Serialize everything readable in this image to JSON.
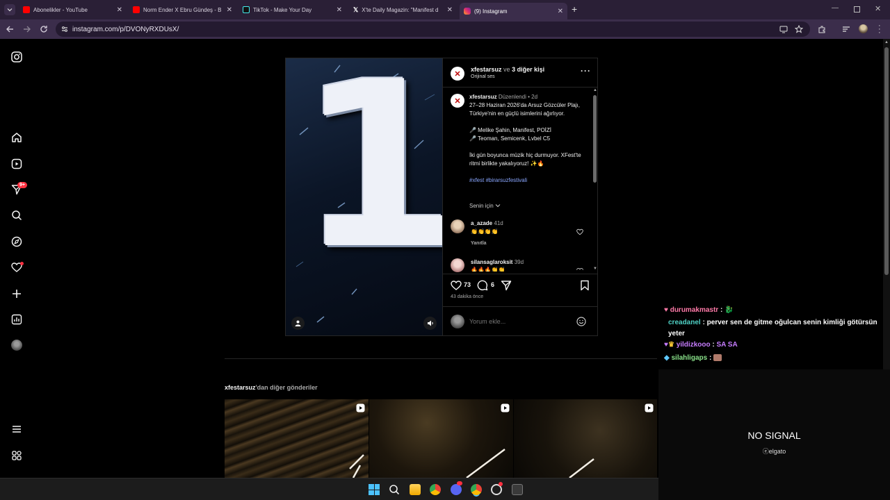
{
  "browser": {
    "tabs": [
      {
        "title": "Abonelikler - YouTube",
        "icon": "youtube-icon",
        "color": "#ff0000"
      },
      {
        "title": "Norm Ender X Ebru Gündeş - B",
        "icon": "youtube-icon",
        "color": "#ff0000"
      },
      {
        "title": "TikTok - Make Your Day",
        "icon": "tiktok-icon",
        "color": "#111111"
      },
      {
        "title": "X'te Daily Magazin: \"Manifest d",
        "icon": "x-icon",
        "color": "#000000"
      },
      {
        "title": "(9) Instagram",
        "icon": "instagram-icon",
        "color": "#e1306c"
      }
    ],
    "url": "instagram.com/p/DVONyRXDUsX/"
  },
  "sidebar": {
    "badge": "9+",
    "items": [
      "instagram-logo",
      "home",
      "reels",
      "messages",
      "search",
      "explore",
      "notifications",
      "create",
      "dashboard",
      "profile",
      "more",
      "also-from-meta"
    ]
  },
  "post": {
    "author": "xfestarsuz",
    "coauthors_connector": "ve",
    "coauthors": "3 diğer kişi",
    "audio": "Orijinal ses",
    "media_number": "1",
    "caption": {
      "username": "xfestarsuz",
      "edited": "Düzenlendi",
      "time": "2d",
      "line1": "27–28 Haziran 2026'da Arsuz Gözcüler Plajı, Türkiye'nin en güçlü isimlerini ağırlıyor.",
      "line2": "🎤 Melike Şahin, Manifest, POİZİ",
      "line3": "🎤 Teoman, Semicenk, Lvbel C5",
      "line4": "İki gün boyunca müzik hiç durmuyor. XFest'te ritmi birlikte yakalıyoruz! ✨🔥",
      "hashtags": "#xfest #birarsuzfestivali"
    },
    "for_you": "Senin için",
    "comments": [
      {
        "username": "a_azade",
        "time": "41d",
        "text": "👏👏👏👏",
        "reply": "Yanıtla"
      },
      {
        "username": "silansaglaroksit",
        "time": "39d",
        "text": "🔥🔥🔥👏👏"
      }
    ],
    "likes": "73",
    "comment_count": "6",
    "timestamp": "43 dakika önce",
    "comment_placeholder": "Yorum ekle..."
  },
  "more_posts": {
    "author": "xfestarsuz",
    "label": "'dan diğer gönderiler"
  },
  "chat": [
    {
      "user": "durumakmastr",
      "user_color": "#ff7aa8",
      "message": ""
    },
    {
      "user": "creadanel",
      "user_color": "#4fd1c5",
      "message": "perver sen de gitme oğulcan senin kimliği götürsün yeter"
    },
    {
      "user": "yildizkooo",
      "user_color": "#c77dff",
      "message": "SA  SA"
    },
    {
      "user": "silahligaps",
      "user_color": "#8be38b",
      "message": ""
    }
  ],
  "overlay": {
    "status": "NO SIGNAL",
    "brand": "elgato"
  },
  "colors": {
    "tab_bar": "#2a1f36",
    "address_bar": "#3b2d4b",
    "link": "#8aa7ff",
    "notification": "#ff3040"
  }
}
